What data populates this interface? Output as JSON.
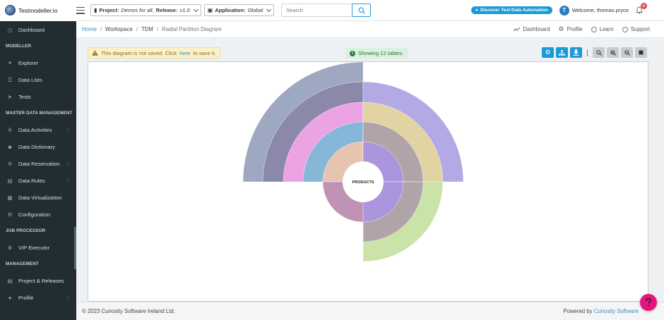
{
  "app": {
    "name": "Testmodeller.io",
    "project_label": "Project:",
    "project_value": "Demos for all,",
    "release_label": "Release:",
    "release_value": "v1.0",
    "application_label": "Application:",
    "application_value": "Global",
    "search_placeholder": "Search",
    "discover_label": "Discover Test Data Automation",
    "welcome": "Welcome, thomas.pryce",
    "avatar_initial": "T",
    "notification_count": "6"
  },
  "sidebar": {
    "items": [
      {
        "type": "item",
        "label": "Dashboard",
        "icon": "dashboard-icon",
        "glyph": "◷",
        "arrow": false
      },
      {
        "type": "section",
        "label": "MODELLER"
      },
      {
        "type": "item",
        "label": "Explorer",
        "icon": "explorer-icon",
        "glyph": "✦",
        "arrow": false
      },
      {
        "type": "item",
        "label": "Data Lists",
        "icon": "list-icon",
        "glyph": "☰",
        "arrow": false
      },
      {
        "type": "item",
        "label": "Tests",
        "icon": "rocket-icon",
        "glyph": "➤",
        "arrow": false
      },
      {
        "type": "section",
        "label": "MASTER DATA MANAGEMENT"
      },
      {
        "type": "item",
        "label": "Data Activities",
        "icon": "activities-icon",
        "glyph": "✣",
        "arrow": true
      },
      {
        "type": "item",
        "label": "Data Dictionary",
        "icon": "dictionary-icon",
        "glyph": "◆",
        "arrow": false
      },
      {
        "type": "item",
        "label": "Data Reservation",
        "icon": "reservation-icon",
        "glyph": "✣",
        "arrow": true
      },
      {
        "type": "item",
        "label": "Data Rules",
        "icon": "rules-icon",
        "glyph": "▤",
        "arrow": true
      },
      {
        "type": "item",
        "label": "Data Virtualization",
        "icon": "virtualization-icon",
        "glyph": "▦",
        "arrow": false
      },
      {
        "type": "item",
        "label": "Configuration",
        "icon": "gear-icon",
        "glyph": "⚙",
        "arrow": false
      },
      {
        "type": "section",
        "label": "JOB PROCESSOR"
      },
      {
        "type": "item",
        "label": "VIP Executor",
        "icon": "executor-icon",
        "glyph": "♛",
        "arrow": false
      },
      {
        "type": "section",
        "label": "MANAGEMENT"
      },
      {
        "type": "item",
        "label": "Project & Releases",
        "icon": "project-icon",
        "glyph": "▤",
        "arrow": false
      },
      {
        "type": "item",
        "label": "Profile",
        "icon": "user-icon",
        "glyph": "●",
        "arrow": true
      }
    ]
  },
  "breadcrumb": {
    "home": "Home",
    "items": [
      "Workspace",
      "TDM"
    ],
    "current": "Radial Partition Diagram",
    "sep": "/"
  },
  "header_links": {
    "dashboard": "Dashboard",
    "profile": "Profile",
    "learn": "Learn",
    "support": "Support"
  },
  "notice": {
    "warning_prefix": "This diagram is not saved. Click",
    "warning_link": "here",
    "warning_suffix": "to save it.",
    "tables_info": "Showing 12 tables."
  },
  "diagram": {
    "center_label": "PRODUCTS",
    "colors": {
      "outer_left": "#9ea8c0",
      "ring2_left": "#8c88aa",
      "ring3_left": "#eba3e3",
      "ring4_left": "#86b6d8",
      "inner_left": "#e6c4b0",
      "outer_right": "#b3a9e4",
      "ring2_right": "#e2d4a2",
      "ring3_right": "#b0a4a8",
      "inner_right": "#ab95dc",
      "bottom_green": "#c9e3a8",
      "bottom_left": "#c092b3"
    }
  },
  "footer": {
    "copyright": "© 2023 Curiosity Software Ireland Ltd.",
    "powered_by": "Powered by",
    "company": "Curiosity Software"
  }
}
